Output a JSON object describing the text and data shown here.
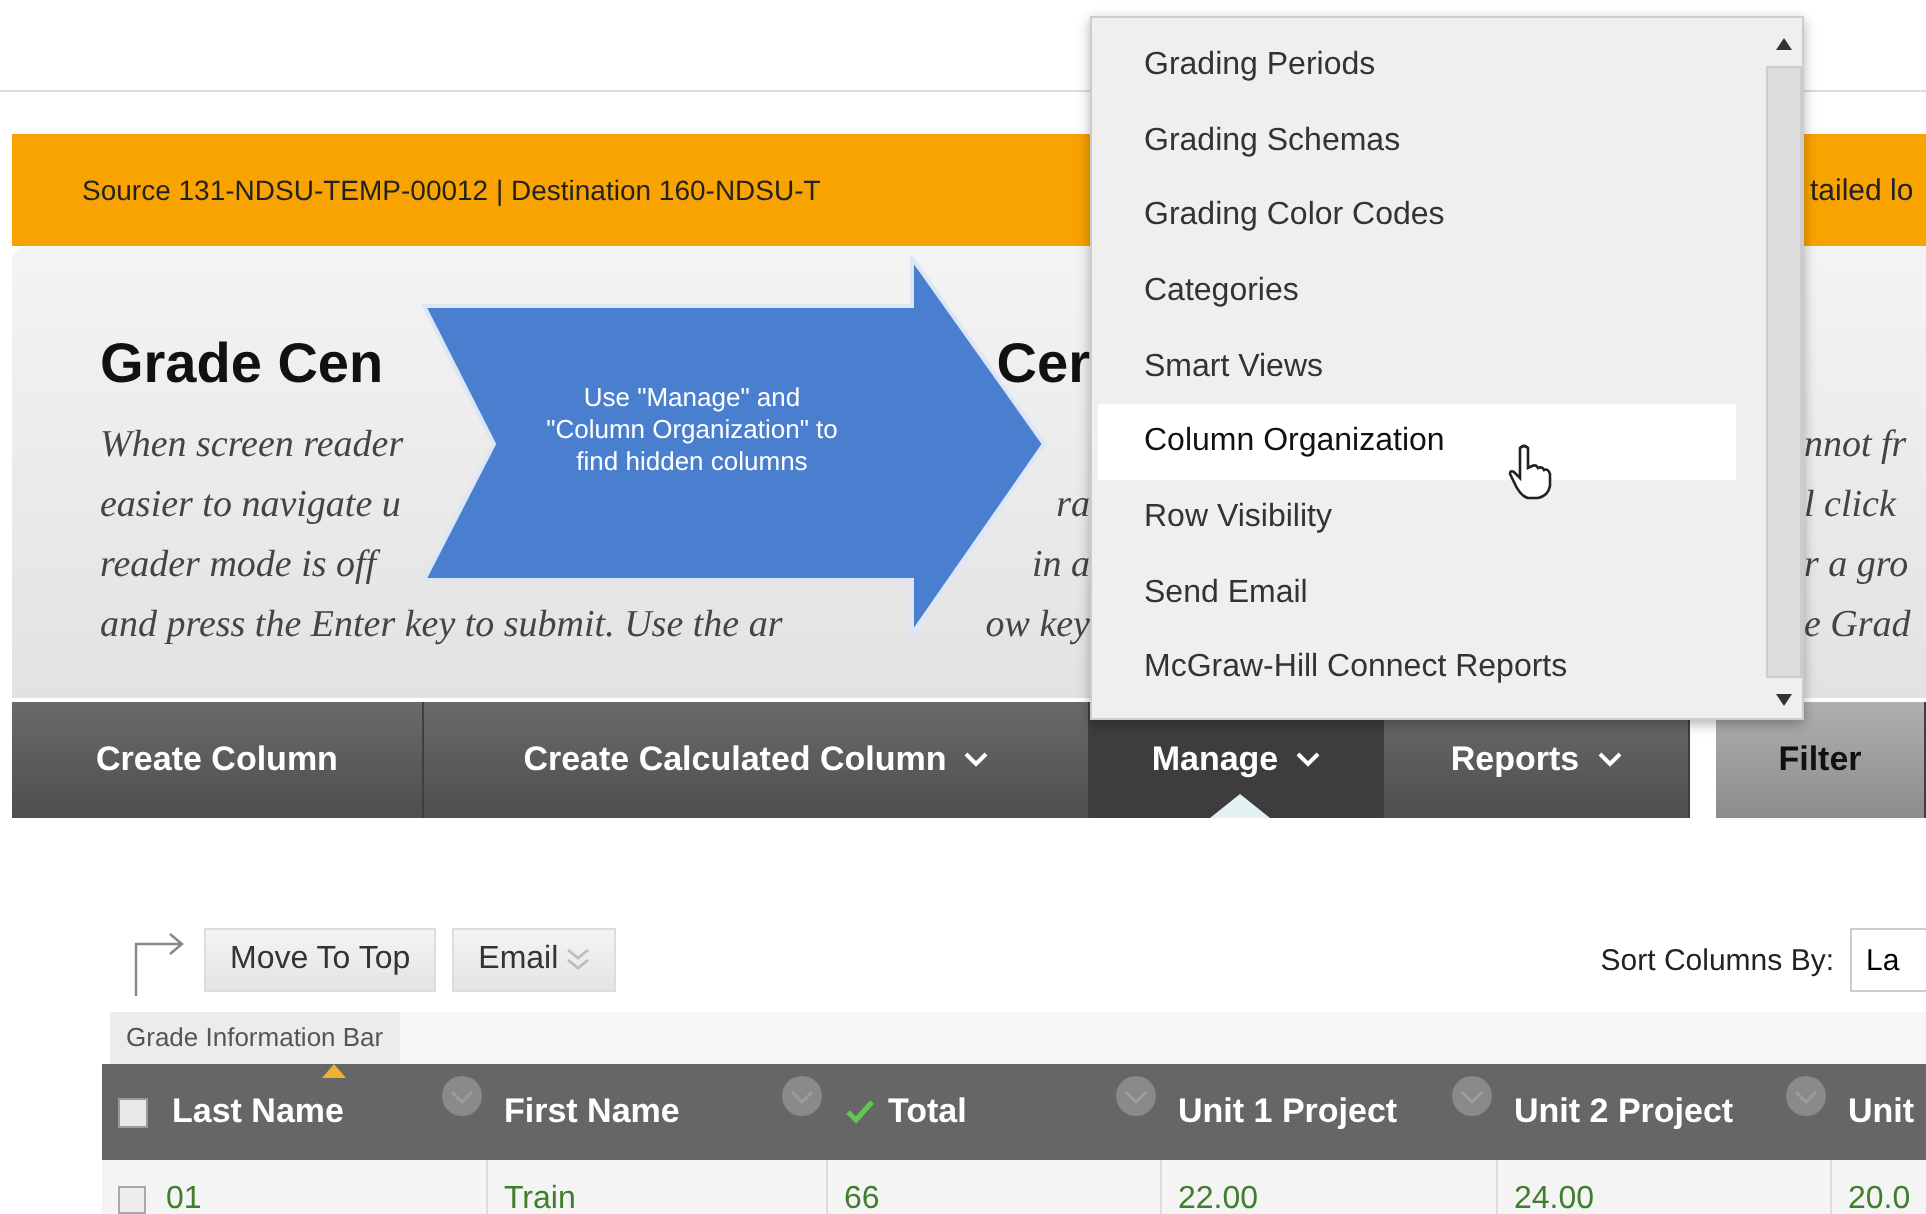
{
  "notice_bar": {
    "text": "Source 131-NDSU-TEMP-00012 | Destination 160-NDSU-T",
    "text_right": "tailed lo"
  },
  "page_title": {
    "text": "Grade Cen",
    "text_after_callout": "Cer"
  },
  "description_lines": [
    {
      "left": "When screen reader",
      "right_of_menu": "nnot fr"
    },
    {
      "left": "easier to navigate u",
      "middle": "ra",
      "right_of_menu": "l click"
    },
    {
      "left": "reader mode is off",
      "middle": "in a",
      "right_of_menu": "r a gro"
    },
    {
      "left": "and press the Enter key to submit. Use the ar",
      "middle": "ow key",
      "right_of_menu": "e Grad"
    }
  ],
  "callout": {
    "text": "Use \"Manage\" and \"Column Organization\" to find hidden columns"
  },
  "nav": [
    {
      "label": "Create Column",
      "kind": "tab",
      "has_dropdown": false,
      "selected": false
    },
    {
      "label": "Create Calculated Column",
      "kind": "tab",
      "has_dropdown": true,
      "selected": false
    },
    {
      "label": "Manage",
      "kind": "tab",
      "has_dropdown": true,
      "selected": true
    },
    {
      "label": "Reports",
      "kind": "tab",
      "has_dropdown": true,
      "selected": false
    },
    {
      "label": "Filter",
      "kind": "filter",
      "has_dropdown": false,
      "selected": false
    }
  ],
  "manage_menu": {
    "items": [
      {
        "label": "Grading Periods",
        "selected": false
      },
      {
        "label": "Grading Schemas",
        "selected": false
      },
      {
        "label": "Grading Color Codes",
        "selected": false
      },
      {
        "label": "Categories",
        "selected": false
      },
      {
        "label": "Smart Views",
        "selected": false
      },
      {
        "label": "Column Organization",
        "selected": true
      },
      {
        "label": "Row Visibility",
        "selected": false
      },
      {
        "label": "Send Email",
        "selected": false
      },
      {
        "label": "McGraw-Hill Connect Reports",
        "selected": false
      }
    ]
  },
  "toolbar": {
    "buttons": [
      {
        "label": "Move To Top",
        "has_dropdown": false
      },
      {
        "label": "Email",
        "has_dropdown": true
      }
    ],
    "sort_label": "Sort Columns By:",
    "sort_value": "La"
  },
  "grade_info_tab": "Grade Information Bar",
  "table": {
    "select_all_checked": false,
    "columns": [
      {
        "label": "Last Name",
        "sorted": true,
        "total": false
      },
      {
        "label": "First Name",
        "sorted": false,
        "total": false
      },
      {
        "label": "Total",
        "sorted": false,
        "total": true
      },
      {
        "label": "Unit 1 Project",
        "sorted": false,
        "total": false
      },
      {
        "label": "Unit 2 Project",
        "sorted": false,
        "total": false
      },
      {
        "label": "Unit",
        "sorted": false,
        "total": false
      }
    ],
    "rows": [
      {
        "checked": false,
        "cells": [
          "01",
          "Train",
          "66",
          "22.00",
          "24.00",
          "20.0"
        ]
      }
    ]
  }
}
